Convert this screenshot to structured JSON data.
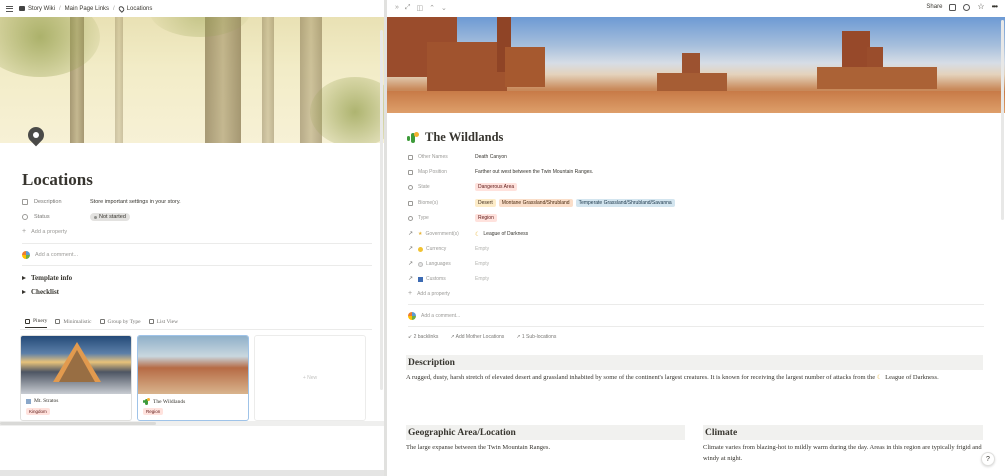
{
  "left": {
    "breadcrumb": [
      "Story Wiki",
      "Main Page Links",
      "Locations"
    ],
    "title": "Locations",
    "properties": [
      {
        "name": "Description",
        "value": "Store important settings in your story."
      },
      {
        "name": "Status",
        "value": "Not started"
      }
    ],
    "add_property": "Add a property",
    "add_comment": "Add a comment...",
    "toggles": [
      "Template info",
      "Checklist"
    ],
    "tabs": [
      "Pinery",
      "Minimalistic",
      "Group by Type",
      "List View"
    ],
    "cards": [
      {
        "name": "Mt. Stratos",
        "tag": "Kingdom"
      },
      {
        "name": "The Wildlands",
        "tag": "Region"
      }
    ],
    "new_label": "+ New"
  },
  "right": {
    "topbar": {
      "share": "Share"
    },
    "title": "The Wildlands",
    "properties": {
      "other_names": {
        "name": "Other Names",
        "value": "Death Canyon"
      },
      "map_position": {
        "name": "Map Position",
        "value": "Farther out west between the Twin Mountain Ranges."
      },
      "state": {
        "name": "State",
        "value": "Dangerous Area"
      },
      "biomes": {
        "name": "Biome(s)",
        "values": [
          "Desert",
          "Montane Grassland/Shrubland",
          "Temperate Grassland/Shrubland/Savanna"
        ]
      },
      "type": {
        "name": "Type",
        "value": "Region"
      },
      "governments": {
        "name": "Government(s)",
        "value": "League of Darkness"
      },
      "currency": {
        "name": "Currency",
        "value": "Empty"
      },
      "languages": {
        "name": "Languages",
        "value": "Empty"
      },
      "customs": {
        "name": "Customs",
        "value": "Empty"
      }
    },
    "add_property": "Add a property",
    "add_comment": "Add a comment...",
    "backlinks": [
      "2 backlinks",
      "Add Mother Locations",
      "1 Sub-locations"
    ],
    "description": {
      "heading": "Description",
      "text_before": "A rugged, dusty, harsh stretch of elevated desert and grassland inhabited by some of the continent's largest creatures. It is known for receiving the largest number of attacks from the",
      "mention": "League of Darkness",
      "text_after": "."
    },
    "geo": {
      "heading": "Geographic Area/Location",
      "text": "The large expanse between the Twin Mountain Ranges."
    },
    "climate": {
      "heading": "Climate",
      "text": "Climate varies from blazing-hot to mildly warm during the day. Areas in this region are typically frigid and windy at night."
    },
    "help": "?"
  },
  "colors": {
    "accent_blue": "#9fc3e8",
    "tag_red": "#ffe2dd",
    "section_bg": "#f1f1ef"
  }
}
